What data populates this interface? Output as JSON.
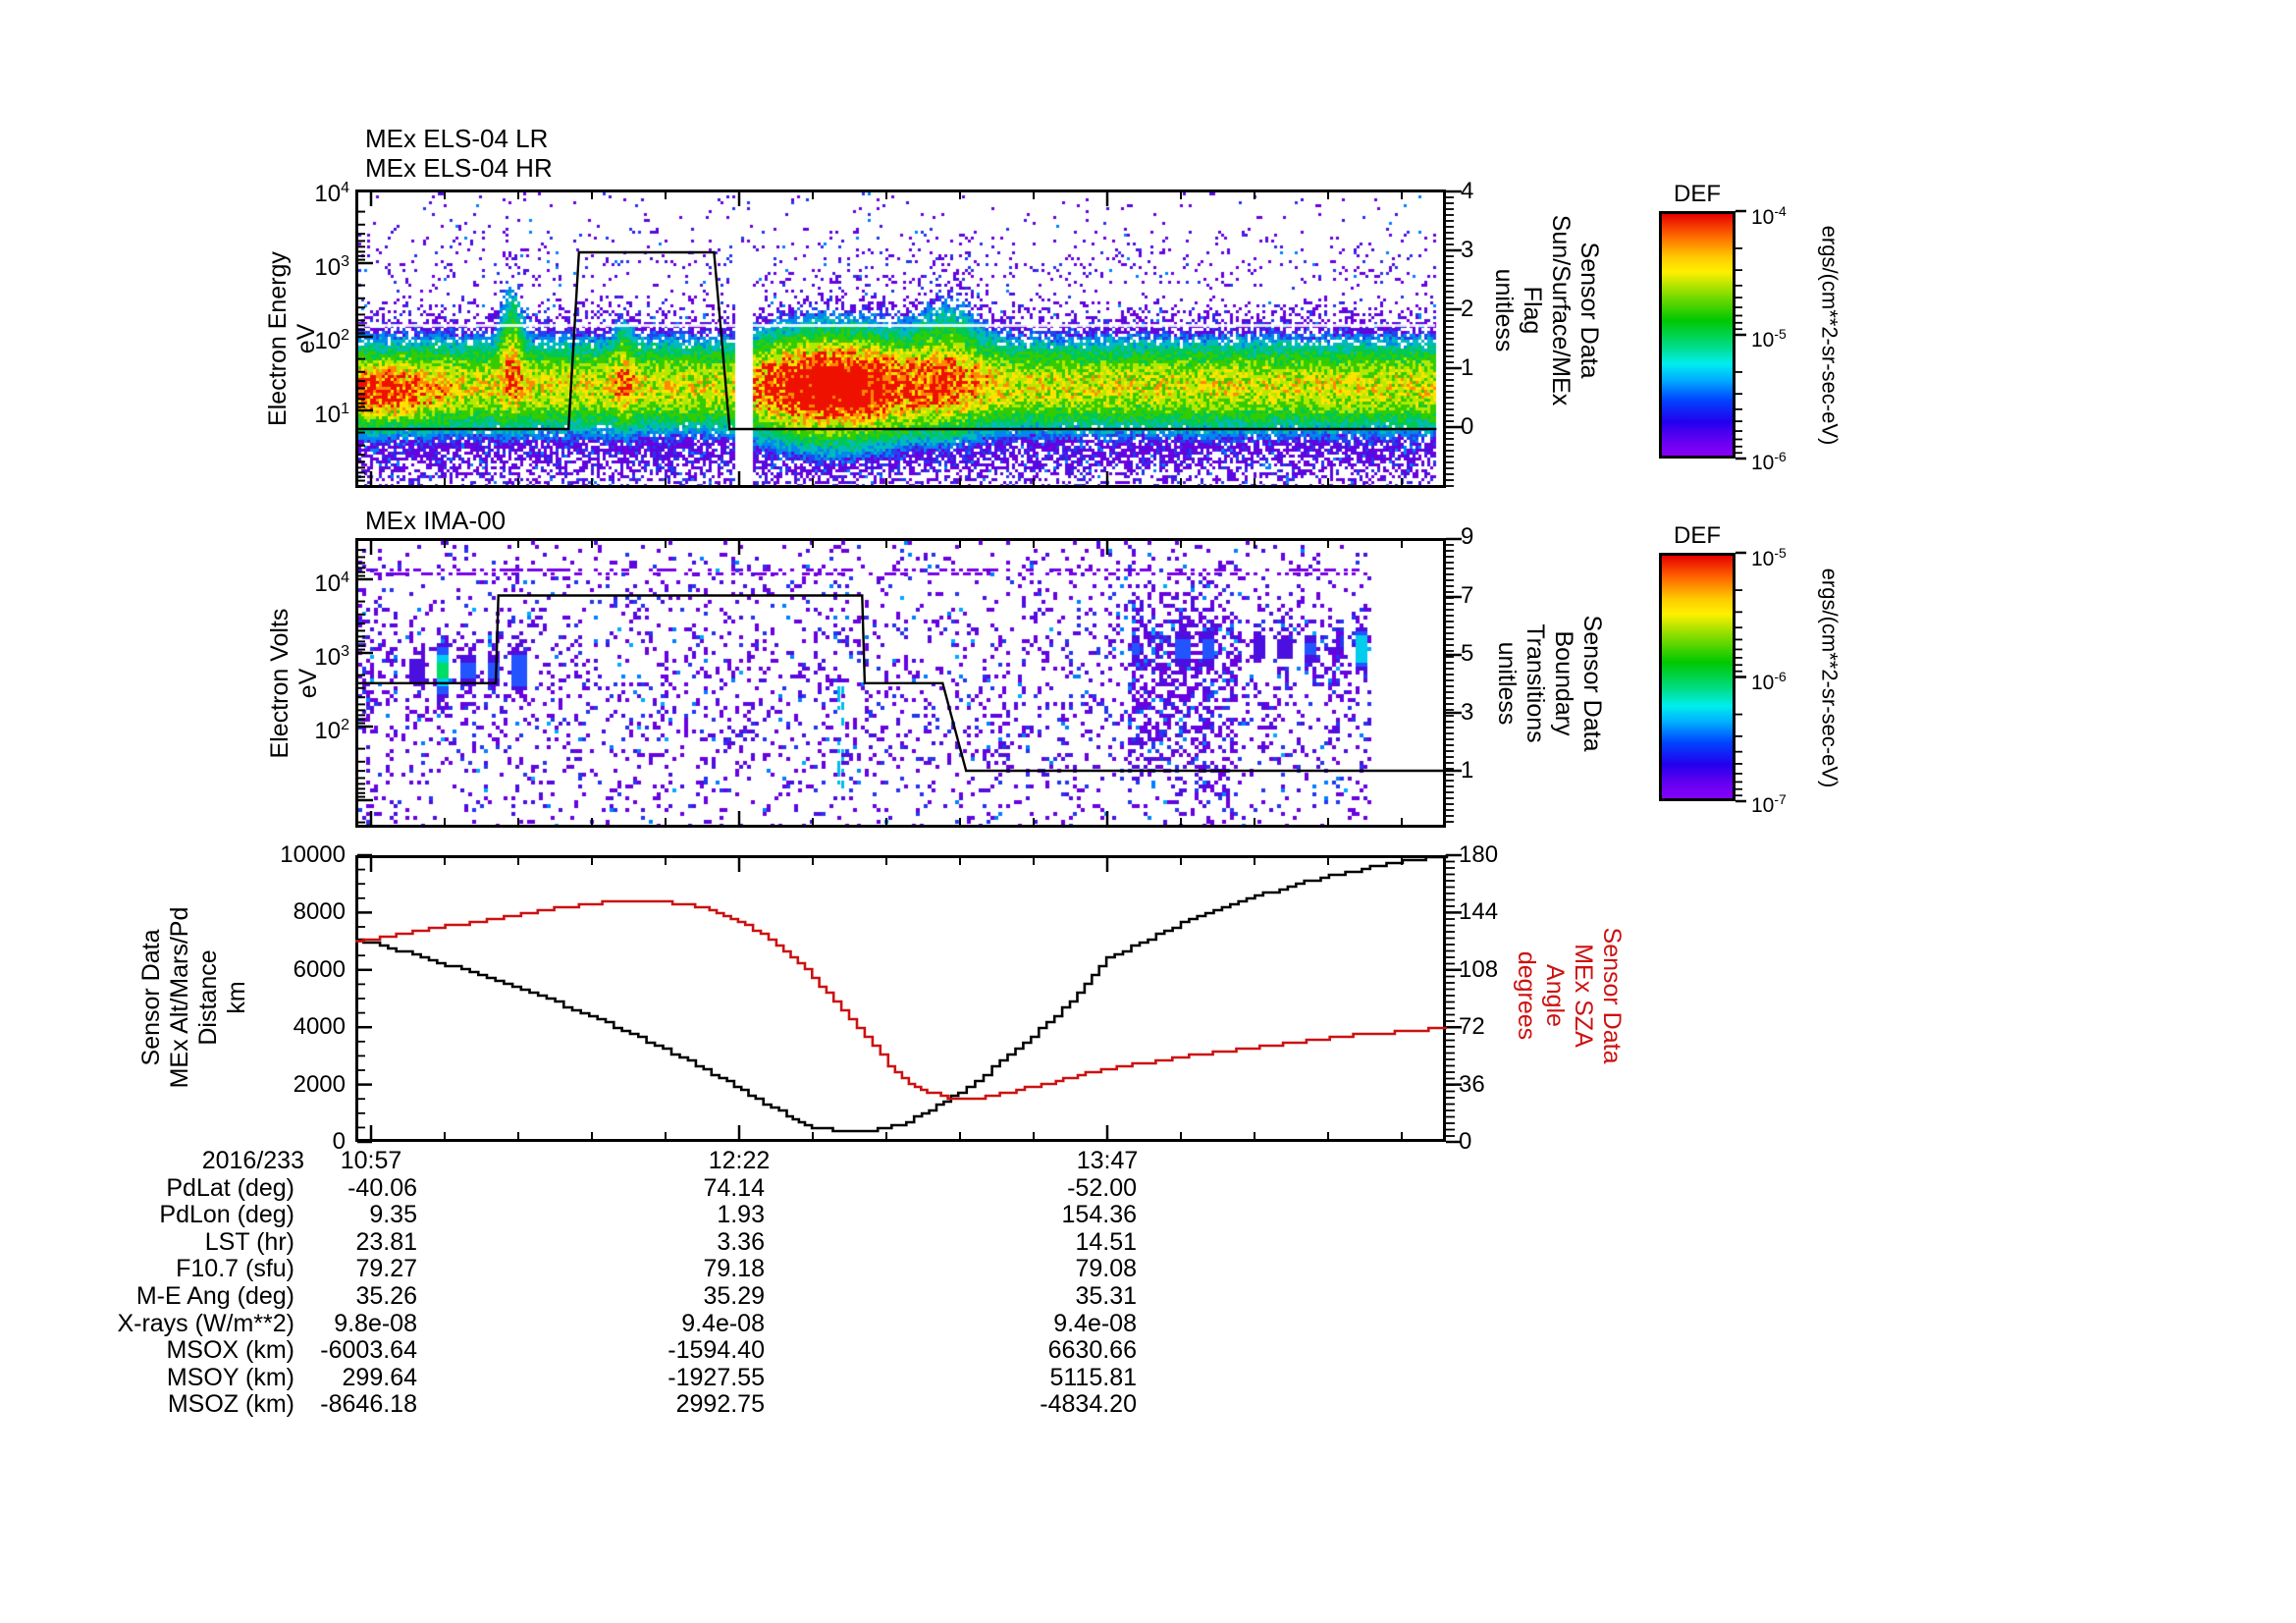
{
  "els": {
    "titles": [
      "MEx ELS-04 LR",
      "MEx ELS-04 HR"
    ],
    "ylabel_lines": [
      "Electron Energy",
      "eV"
    ],
    "yticks": [
      {
        "base": "10",
        "exp": "4"
      },
      {
        "base": "10",
        "exp": "3"
      },
      {
        "base": "10",
        "exp": "2"
      },
      {
        "base": "10",
        "exp": "1"
      }
    ],
    "right_axis": {
      "labels": [
        "4",
        "3",
        "2",
        "1",
        "0"
      ],
      "title_lines": [
        "Sensor Data",
        "Sun/Surface/MEx",
        "Flag",
        "unitless"
      ]
    }
  },
  "ima": {
    "title": "MEx IMA-00",
    "ylabel_lines": [
      "Electron Volts",
      "eV"
    ],
    "yticks": [
      {
        "base": "10",
        "exp": "4"
      },
      {
        "base": "10",
        "exp": "3"
      },
      {
        "base": "10",
        "exp": "2"
      }
    ],
    "right_axis": {
      "labels": [
        "9",
        "7",
        "5",
        "3",
        "1"
      ],
      "title_lines": [
        "Sensor Data",
        "Boundary",
        "Transitions",
        "unitless"
      ]
    }
  },
  "colorbars": [
    {
      "title": "DEF",
      "unit": "ergs/(cm**2-sr-sec-eV)",
      "ticks": [
        {
          "base": "10",
          "exp": "-4"
        },
        {
          "base": "10",
          "exp": "-5"
        },
        {
          "base": "10",
          "exp": "-6"
        }
      ]
    },
    {
      "title": "DEF",
      "unit": "ergs/(cm**2-sr-sec-eV)",
      "ticks": [
        {
          "base": "10",
          "exp": "-5"
        },
        {
          "base": "10",
          "exp": "-6"
        },
        {
          "base": "10",
          "exp": "-7"
        }
      ]
    }
  ],
  "timeseries": {
    "left_axis": {
      "ticks": [
        "10000",
        "8000",
        "6000",
        "4000",
        "2000",
        "0"
      ],
      "title_lines": [
        "Sensor Data",
        "MEx Alt/Mars/Pd",
        "Distance",
        "km"
      ]
    },
    "right_axis": {
      "ticks": [
        "180",
        "144",
        "108",
        "72",
        "36",
        "0"
      ],
      "title_lines": [
        "Sensor Data",
        "MEx SZA",
        "Angle",
        "degrees"
      ],
      "color": "#cc1111"
    }
  },
  "xaxis": {
    "date": "2016/233",
    "ticks": [
      "10:57",
      "12:22",
      "13:47"
    ]
  },
  "table": {
    "rows": [
      {
        "label": "PdLat (deg)",
        "values": [
          "-40.06",
          "74.14",
          "-52.00"
        ]
      },
      {
        "label": "PdLon (deg)",
        "values": [
          "9.35",
          "1.93",
          "154.36"
        ]
      },
      {
        "label": "LST (hr)",
        "values": [
          "23.81",
          "3.36",
          "14.51"
        ]
      },
      {
        "label": "F10.7 (sfu)",
        "values": [
          "79.27",
          "79.18",
          "79.08"
        ]
      },
      {
        "label": "M-E Ang (deg)",
        "values": [
          "35.26",
          "35.29",
          "35.31"
        ]
      },
      {
        "label": "X-rays (W/m**2)",
        "values": [
          "9.8e-08",
          "9.4e-08",
          "9.4e-08"
        ]
      },
      {
        "label": "MSOX (km)",
        "values": [
          "-6003.64",
          "-1594.40",
          "6630.66"
        ]
      },
      {
        "label": "MSOY (km)",
        "values": [
          "299.64",
          "-1927.55",
          "5115.81"
        ]
      },
      {
        "label": "MSOZ (km)",
        "values": [
          "-8646.18",
          "2992.75",
          "-4834.20"
        ]
      }
    ]
  },
  "chart_data": [
    {
      "type": "heatmap",
      "title": "MEx ELS-04 LR / MEx ELS-04 HR electron energy spectrogram",
      "xlabel": "time on 2016/233",
      "x_ticks": [
        "10:57",
        "12:22",
        "13:47"
      ],
      "ylabel": "Electron Energy eV",
      "yscale": "log",
      "ylim": [
        1,
        10000
      ],
      "colorbar": {
        "title": "DEF",
        "unit": "ergs/(cm**2-sr-sec-eV)",
        "range": [
          1e-06,
          0.0001
        ]
      },
      "features": [
        "intense green/yellow 10-100 eV band along entire interval",
        "red-orange enhancement 20-40 eV near start (10:57-11:05)",
        "narrow data gap near 12:18",
        "strong red enhancement 20-200 eV from ~12:20 to ~12:45",
        "sparse purple/blue suprathermal speckle up to ~500 eV",
        "thin light horizontal line near 150 eV"
      ],
      "overlay": {
        "name": "Sensor Data Sun/Surface/MEx Flag",
        "axis_labels": [
          4,
          3,
          2,
          1,
          0
        ],
        "points_t_hours_vs_flag": [
          [
            10.89,
            0
          ],
          [
            11.71,
            0
          ],
          [
            11.75,
            3
          ],
          [
            12.27,
            3
          ],
          [
            12.33,
            0
          ],
          [
            15.05,
            0
          ]
        ]
      }
    },
    {
      "type": "heatmap",
      "title": "MEx IMA-00 ion spectrogram",
      "xlabel": "time on 2016/233",
      "x_ticks": [
        "10:57",
        "12:22",
        "13:47"
      ],
      "ylabel": "Electron Volts eV",
      "yscale": "log",
      "ylim": [
        5,
        30000
      ],
      "colorbar": {
        "title": "DEF",
        "unit": "ergs/(cm**2-sr-sec-eV)",
        "range": [
          1e-07,
          1e-05
        ]
      },
      "features": [
        "sparse purple background counts over full energy range",
        "blue/cyan periodic stripes 0.5-4 keV before ~11:30",
        "dense purple cluster ~13:05-13:25",
        "periodic blue/cyan/green stripes ~1-3 keV after ~13:05",
        "data ends before right edge of panel"
      ],
      "overlay": {
        "name": "Sensor Data Boundary Transitions",
        "axis_labels": [
          9,
          7,
          5,
          3,
          1
        ],
        "points_t_hours_vs_level": [
          [
            10.89,
            4
          ],
          [
            11.43,
            4
          ],
          [
            11.44,
            7
          ],
          [
            12.84,
            7
          ],
          [
            12.85,
            4
          ],
          [
            13.15,
            4
          ],
          [
            13.24,
            1
          ],
          [
            15.09,
            1
          ]
        ]
      }
    },
    {
      "type": "line",
      "x_unit": "decimal hours on 2016/233",
      "x_ticks": [
        "10:57",
        "12:22",
        "13:47"
      ],
      "series": [
        {
          "name": "Sensor Data MEx Alt/Mars/Pd Distance (km)",
          "color": "#000000",
          "axis": "left",
          "ylim": [
            0,
            10000
          ],
          "points": [
            [
              10.89,
              7050
            ],
            [
              11.11,
              6550
            ],
            [
              11.33,
              5900
            ],
            [
              11.56,
              5200
            ],
            [
              11.79,
              4400
            ],
            [
              12.01,
              3500
            ],
            [
              12.17,
              2800
            ],
            [
              12.32,
              2100
            ],
            [
              12.43,
              1500
            ],
            [
              12.55,
              900
            ],
            [
              12.62,
              550
            ],
            [
              12.7,
              430
            ],
            [
              12.81,
              400
            ],
            [
              12.9,
              430
            ],
            [
              12.98,
              600
            ],
            [
              13.07,
              1000
            ],
            [
              13.21,
              1700
            ],
            [
              13.34,
              2600
            ],
            [
              13.49,
              3700
            ],
            [
              13.64,
              4900
            ],
            [
              13.78,
              6400
            ],
            [
              13.94,
              7100
            ],
            [
              14.13,
              7900
            ],
            [
              14.32,
              8500
            ],
            [
              14.51,
              9000
            ],
            [
              14.7,
              9400
            ],
            [
              14.89,
              9750
            ],
            [
              15.04,
              9950
            ],
            [
              15.09,
              10000
            ]
          ]
        },
        {
          "name": "Sensor Data MEx SZA Angle (degrees)",
          "color": "#cc1111",
          "axis": "right",
          "ylim": [
            0,
            180
          ],
          "points": [
            [
              10.89,
              126
            ],
            [
              11.11,
              132
            ],
            [
              11.33,
              138
            ],
            [
              11.56,
              144
            ],
            [
              11.75,
              149
            ],
            [
              11.9,
              151
            ],
            [
              12.05,
              151
            ],
            [
              12.17,
              149
            ],
            [
              12.28,
              144
            ],
            [
              12.39,
              136
            ],
            [
              12.51,
              124
            ],
            [
              12.62,
              108
            ],
            [
              12.73,
              88
            ],
            [
              12.85,
              66
            ],
            [
              12.94,
              48
            ],
            [
              13.02,
              37
            ],
            [
              13.09,
              31
            ],
            [
              13.17,
              28
            ],
            [
              13.26,
              27
            ],
            [
              13.37,
              30
            ],
            [
              13.53,
              36
            ],
            [
              13.67,
              42
            ],
            [
              13.82,
              47
            ],
            [
              13.97,
              51
            ],
            [
              14.13,
              55
            ],
            [
              14.28,
              58
            ],
            [
              14.43,
              61
            ],
            [
              14.58,
              64
            ],
            [
              14.73,
              67
            ],
            [
              14.89,
              69
            ],
            [
              15.02,
              71
            ],
            [
              15.09,
              72
            ]
          ]
        }
      ]
    }
  ]
}
